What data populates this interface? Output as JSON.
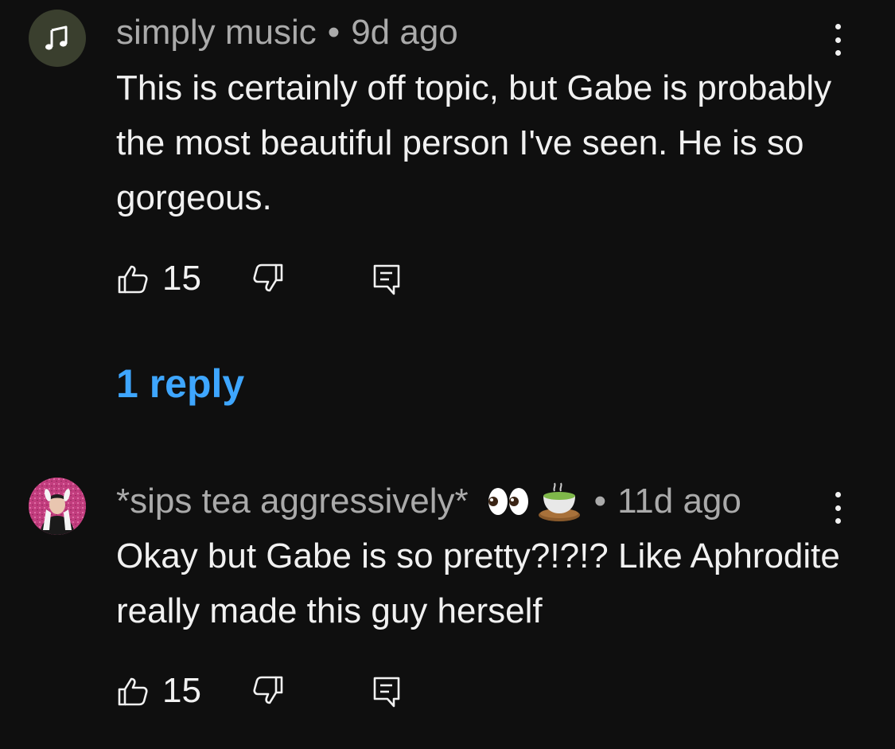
{
  "comments": [
    {
      "author": "simply music",
      "separator": "•",
      "time": "9d ago",
      "avatar_icon": "music-note-icon",
      "avatar_color": "#3a3f2e",
      "text": "This is certainly off topic, but Gabe is probably the most beautiful person I've seen. He is so gorgeous.",
      "likes": "15",
      "replies_label": "1 reply"
    },
    {
      "author": "*sips tea aggressively*",
      "emojis": [
        "eyes-emoji",
        "tea-emoji"
      ],
      "separator": "•",
      "time": "11d ago",
      "avatar_color": "#c0407a",
      "text": "Okay but Gabe is so pretty?!?!? Like Aphrodite really made this guy herself",
      "likes": "15"
    }
  ],
  "colors": {
    "background": "#0f0f0f",
    "primary_text": "#f1f1f1",
    "secondary_text": "#aaaaaa",
    "link": "#3ea6ff"
  }
}
